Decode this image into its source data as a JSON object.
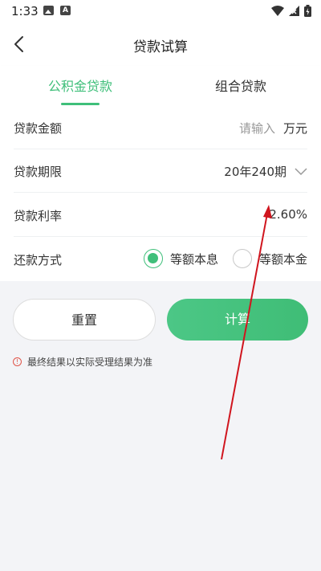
{
  "status_bar": {
    "time": "1:33"
  },
  "header": {
    "title": "贷款试算"
  },
  "tabs": [
    {
      "label": "公积金贷款",
      "active": true
    },
    {
      "label": "组合贷款",
      "active": false
    }
  ],
  "form": {
    "amount": {
      "label": "贷款金额",
      "placeholder": "请输入",
      "unit": "万元"
    },
    "term": {
      "label": "贷款期限",
      "value": "20年240期"
    },
    "rate": {
      "label": "贷款利率",
      "value": "2.60%"
    },
    "method": {
      "label": "还款方式",
      "options": [
        {
          "label": "等额本息",
          "selected": true
        },
        {
          "label": "等额本金",
          "selected": false
        }
      ]
    }
  },
  "buttons": {
    "reset": "重置",
    "calculate": "计算"
  },
  "notice": "最终结果以实际受理结果为准",
  "colors": {
    "accent": "#3fbf7a",
    "annotation": "#d0151e",
    "warning": "#e0554a"
  }
}
